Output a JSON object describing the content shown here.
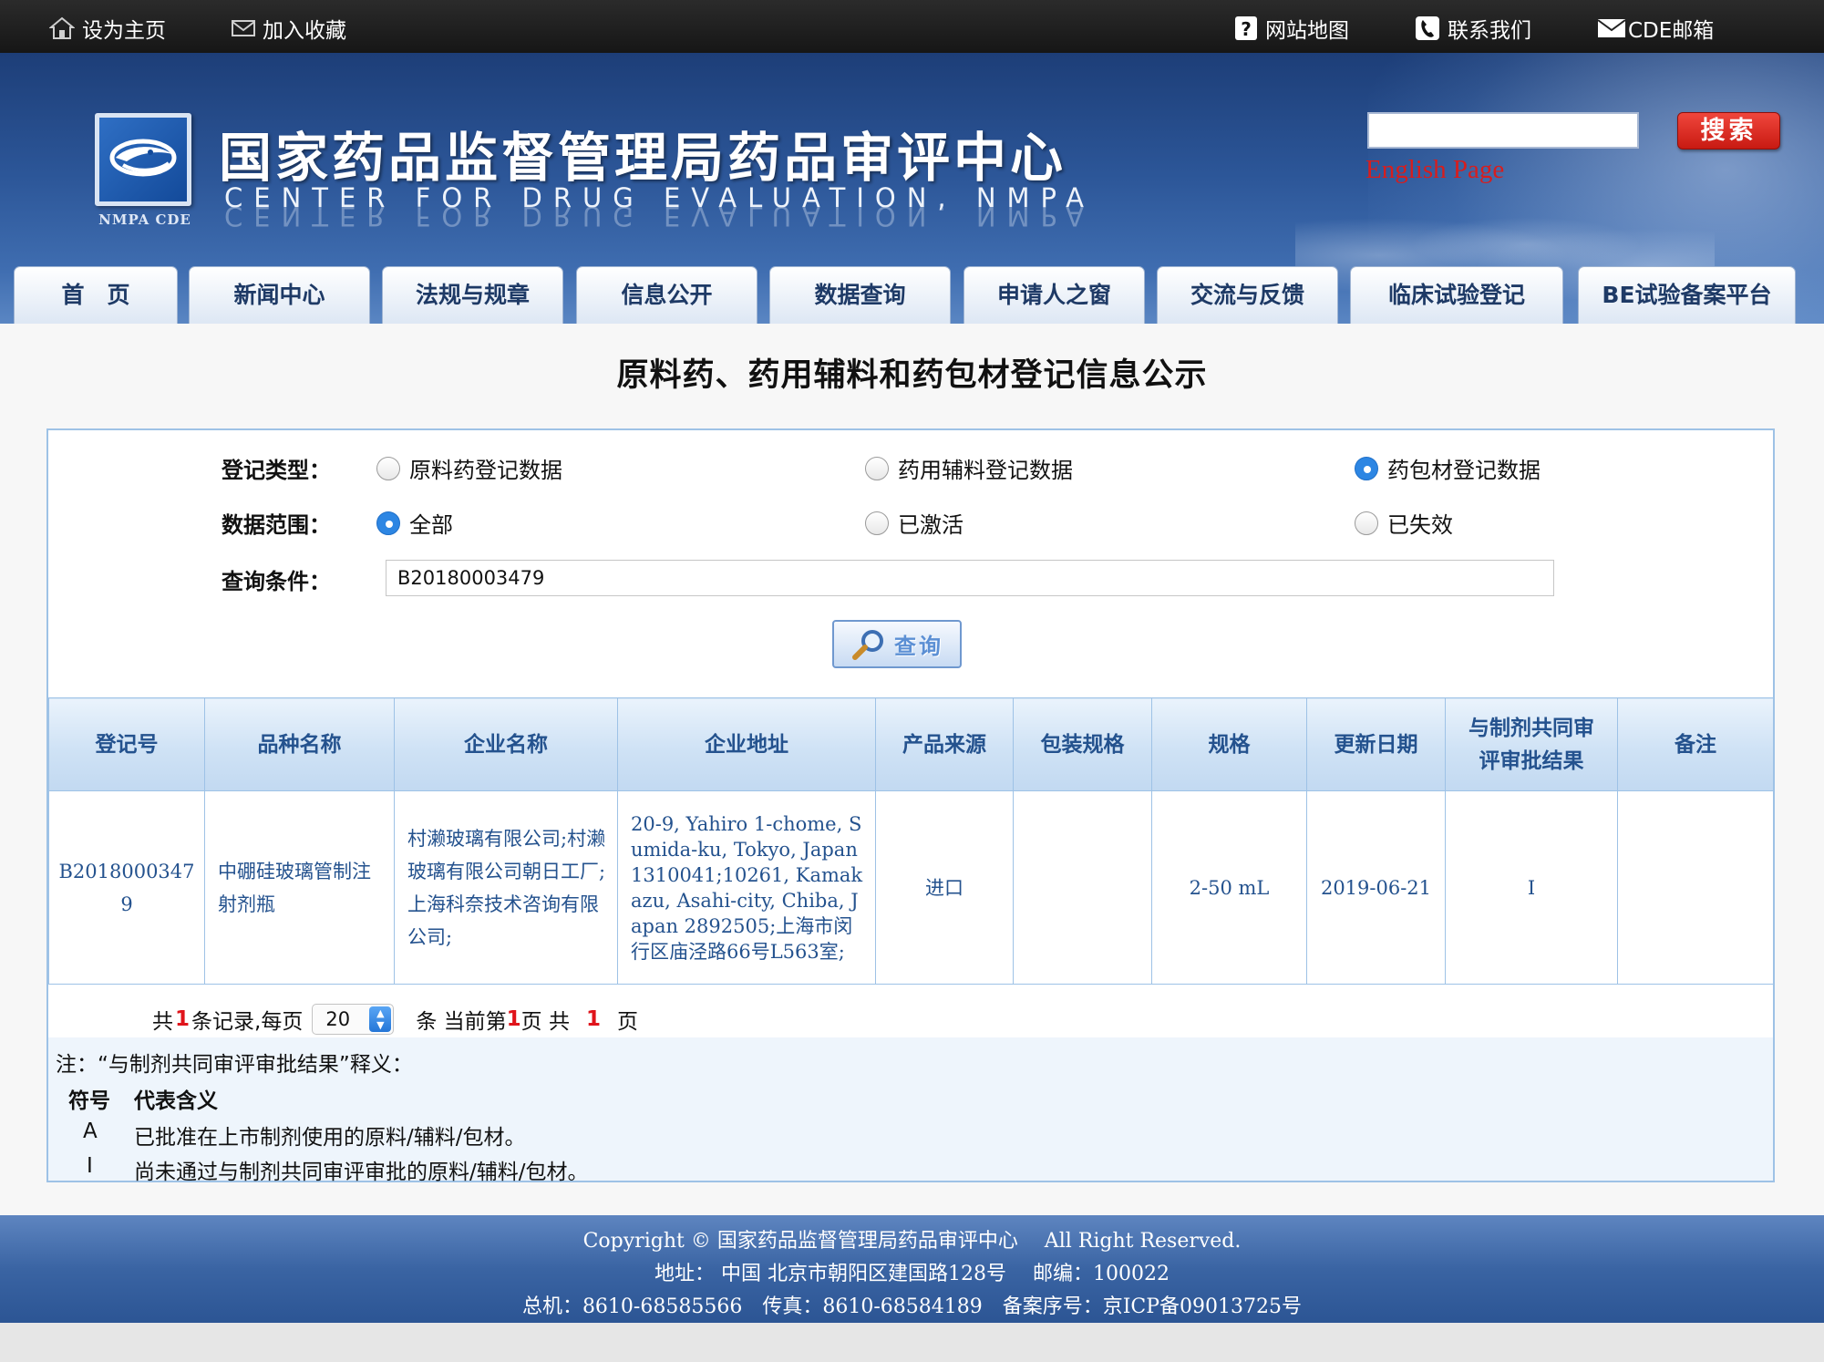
{
  "topbar": {
    "set_home": "设为主页",
    "add_favorite": "加入收藏",
    "site_map": "网站地图",
    "contact_us": "联系我们",
    "cde_mail": "CDE邮箱"
  },
  "header": {
    "title_cn": "国家药品监督管理局药品审评中心",
    "title_en": "CENTER FOR DRUG EVALUATION, NMPA",
    "logo_text": "NMPA CDE",
    "search_placeholder": "",
    "search_button": "搜索",
    "english_link": "English Page"
  },
  "nav": {
    "tabs": [
      "首　页",
      "新闻中心",
      "法规与规章",
      "信息公开",
      "数据查询",
      "申请人之窗",
      "交流与反馈",
      "临床试验登记",
      "BE试验备案平台"
    ]
  },
  "page": {
    "title": "原料药、药用辅料和药包材登记信息公示"
  },
  "form": {
    "type_label": "登记类型：",
    "type_options": [
      "原料药登记数据",
      "药用辅料登记数据",
      "药包材登记数据"
    ],
    "type_selected": "药包材登记数据",
    "scope_label": "数据范围：",
    "scope_options": [
      "全部",
      "已激活",
      "已失效"
    ],
    "scope_selected": "全部",
    "query_label": "查询条件：",
    "query_value": "B20180003479",
    "query_button": "查询"
  },
  "table": {
    "headers": [
      "登记号",
      "品种名称",
      "企业名称",
      "企业地址",
      "产品来源",
      "包装规格",
      "规格",
      "更新日期",
      "与制剂共同审评审批结果",
      "备注"
    ],
    "rows": [
      {
        "reg_no": "B20180003479",
        "product_name": "中硼硅玻璃管制注射剂瓶",
        "company": "村濑玻璃有限公司;村濑玻璃有限公司朝日工厂;上海科奈技术咨询有限公司;",
        "address": "20-9, Yahiro 1-chome, Sumida-ku, Tokyo, Japan 1310041;10261, Kamakazu, Asahi-city, Chiba, Japan 2892505;上海市闵行区庙泾路66号L563室;",
        "source": "进口",
        "package_spec": "",
        "spec": "2-50 mL",
        "update_date": "2019-06-21",
        "review_result": "I",
        "remark": ""
      }
    ]
  },
  "pager": {
    "prefix": "共",
    "total": "1",
    "per_page_text": "条记录,每页",
    "page_size": "20",
    "current_prefix": "条 当前第",
    "current_page": "1",
    "pages_prefix": "页 共",
    "total_pages": "1",
    "pages_suffix": "页"
  },
  "note": {
    "title": "注：“与制剂共同审评审批结果”释义：",
    "col_symbol": "符号",
    "col_meaning": "代表含义",
    "items": [
      {
        "symbol": "A",
        "meaning": "已批准在上市制剂使用的原料/辅料/包材。"
      },
      {
        "symbol": "I",
        "meaning": "尚未通过与制剂共同审评审批的原料/辅料/包材。"
      }
    ]
  },
  "footer": {
    "line1": "Copyright © 国家药品监督管理局药品审评中心　 All Right Reserved.",
    "line2": "地址： 中国  北京市朝阳区建国路128号　 邮编：100022",
    "line3": "总机：8610-68585566　传真：8610-68584189　备案序号：京ICP备09013725号"
  },
  "colors": {
    "banner": "#2c5698",
    "accent_blue": "#24528e",
    "radio_on": "#2d86e3",
    "search_red": "#d81d1d",
    "table_border": "#9ec2e6"
  },
  "icons": [
    "home-icon",
    "mail-icon",
    "help-icon",
    "phone-icon",
    "envelope-icon",
    "magnifier-icon",
    "stepper-icon"
  ]
}
